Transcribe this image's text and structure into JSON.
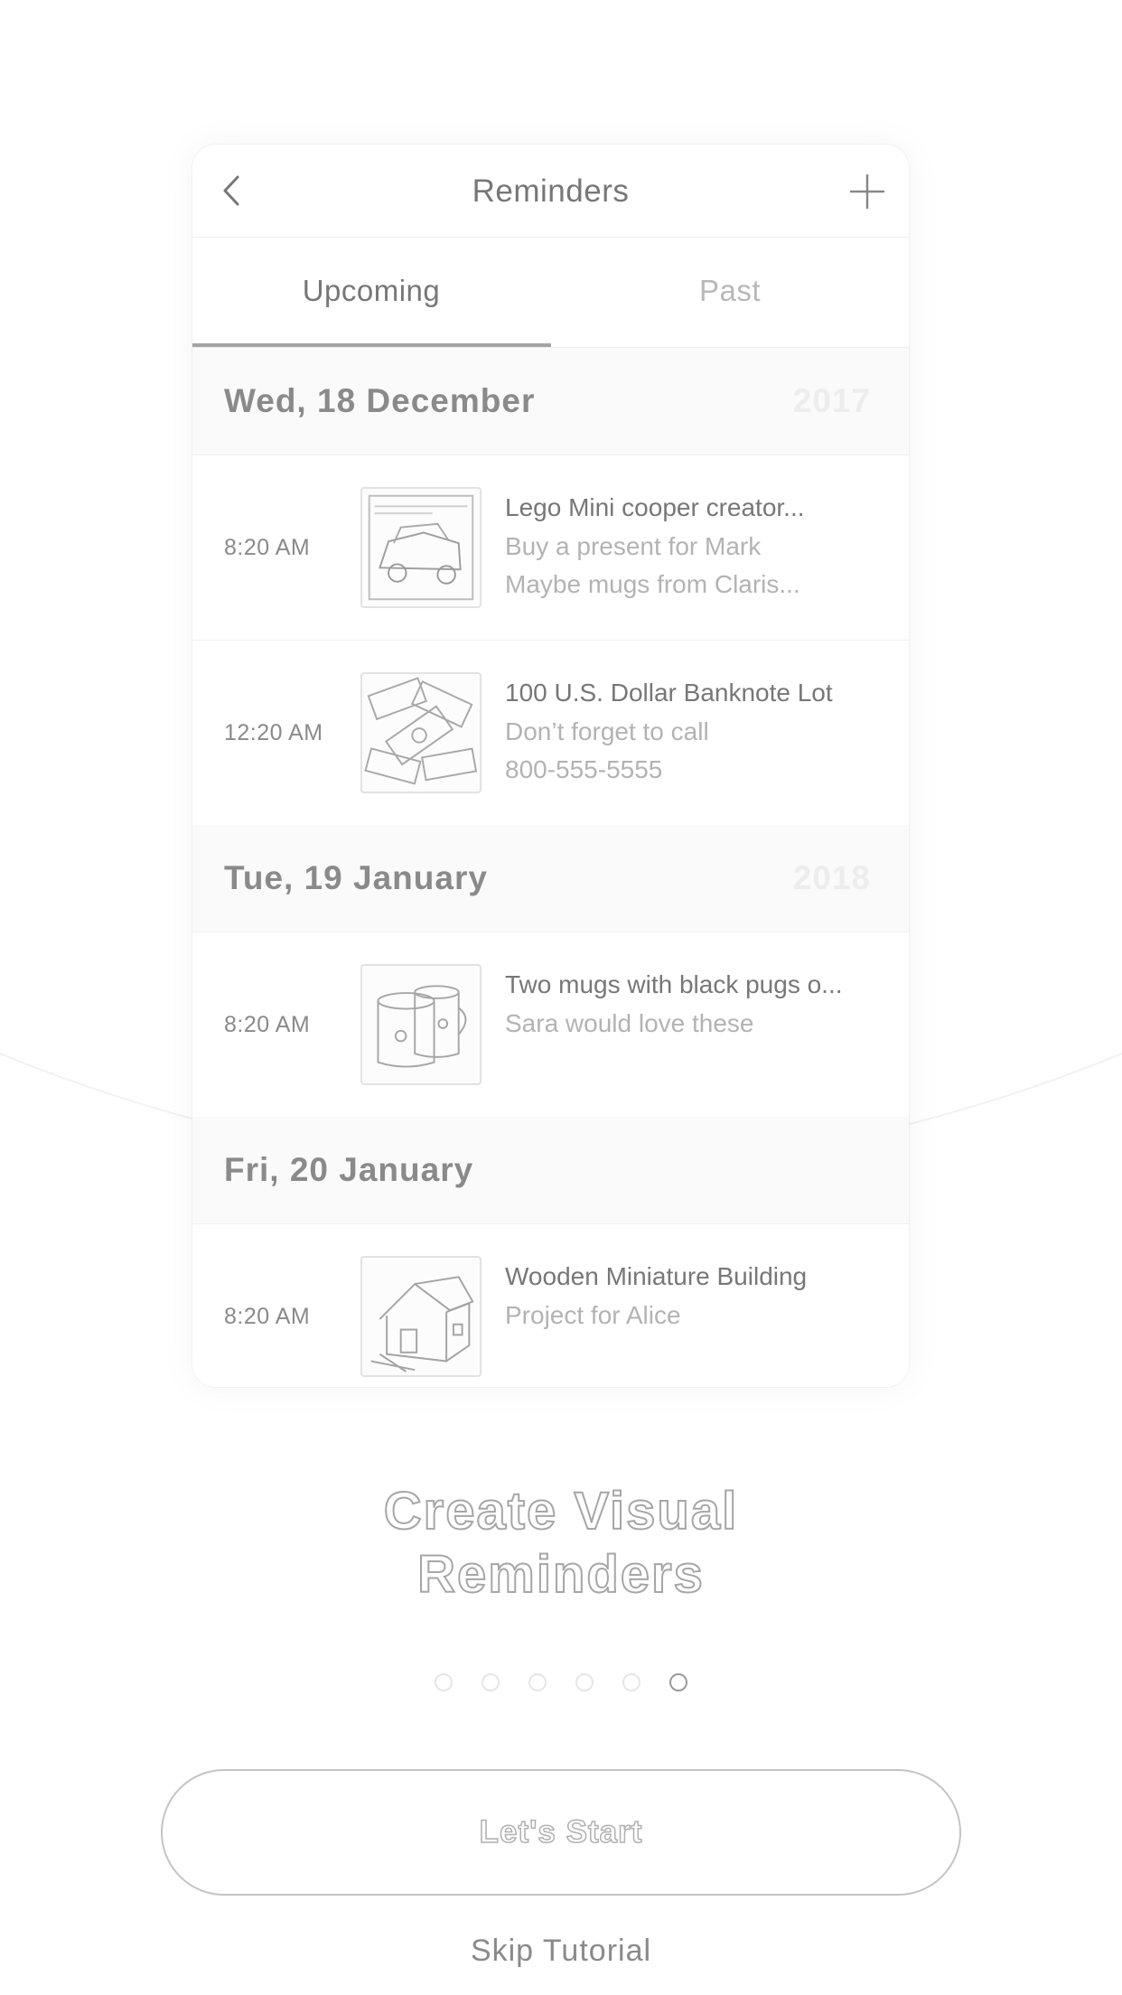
{
  "nav": {
    "title": "Reminders"
  },
  "tabs": [
    {
      "label": "Upcoming"
    },
    {
      "label": "Past"
    }
  ],
  "groups": [
    {
      "date": "Wed, 18 December",
      "year": "2017",
      "items": [
        {
          "time": "8:20 AM",
          "title": "Lego Mini cooper creator...",
          "line2": "Buy a present for Mark",
          "line3": "Maybe mugs from Claris...",
          "thumb": "lego-car-thumbnail"
        },
        {
          "time": "12:20 AM",
          "title": "100 U.S. Dollar Banknote Lot",
          "line2": "Don’t forget to call",
          "line3": "800-555-5555",
          "thumb": "banknotes-thumbnail"
        }
      ]
    },
    {
      "date": "Tue, 19 January",
      "year": "2018",
      "items": [
        {
          "time": "8:20 AM",
          "title": "Two mugs with black pugs o...",
          "line2": "Sara would love these",
          "thumb": "mugs-thumbnail"
        }
      ]
    },
    {
      "date": "Fri, 20 January",
      "items": [
        {
          "time": "8:20 AM",
          "title": "Wooden Miniature Building",
          "line2": "Project for Alice",
          "thumb": "wooden-house-thumbnail"
        }
      ]
    }
  ],
  "onboarding": {
    "headline_line1": "Create Visual",
    "headline_line2": "Reminders",
    "page_count": 6,
    "current_page": 6,
    "start_label": "Let's Start",
    "skip_label": "Skip Tutorial"
  }
}
